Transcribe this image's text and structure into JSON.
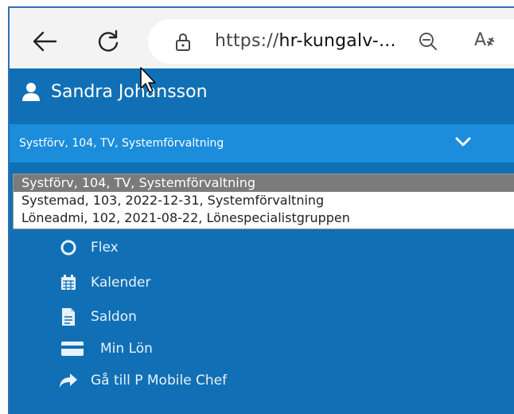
{
  "browser": {
    "url_prefix": "https://",
    "url_host": "hr-kungalv-...",
    "read_aloud_label": "A҂"
  },
  "app": {
    "user_name": "Sandra Johansson",
    "selected_assignment": "Systförv, 104, TV, Systemförvaltning",
    "assignment_options": [
      "Systförv, 104, TV, Systemförvaltning",
      "Systemad, 103, 2022-12-31, Systemförvaltning",
      "Löneadmi, 102, 2021-08-22, Lönespecialistgruppen"
    ],
    "menu": [
      {
        "label": "Flex",
        "icon": "clock-icon"
      },
      {
        "label": "Kalender",
        "icon": "calendar-icon"
      },
      {
        "label": "Saldon",
        "icon": "document-icon"
      },
      {
        "label": "Min Lön",
        "icon": "credit-card-icon"
      },
      {
        "label": "Gå till P Mobile Chef",
        "icon": "share-arrow-icon"
      }
    ]
  },
  "colors": {
    "app_bg": "#1170b5",
    "selector_bg": "#1b8ddb",
    "selected_option_bg": "#7b7b7b"
  }
}
